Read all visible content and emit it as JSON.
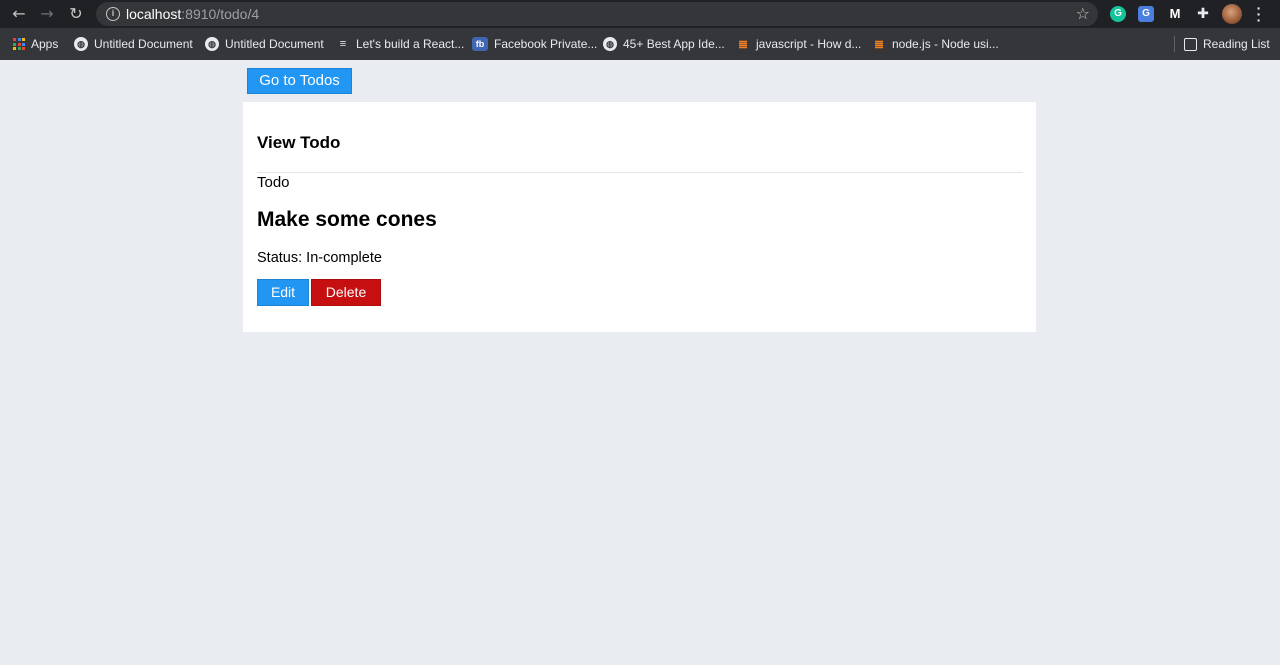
{
  "browser": {
    "url_host": "localhost",
    "url_path": ":8910/todo/4",
    "bookmarks": [
      {
        "label": "Apps",
        "icon": "apps-grid-icon"
      },
      {
        "label": "Untitled Document",
        "icon": "globe-icon"
      },
      {
        "label": "Untitled Document",
        "icon": "globe-icon"
      },
      {
        "label": "Let's build a React...",
        "icon": "list-icon"
      },
      {
        "label": "Facebook Private...",
        "icon": "fb-icon"
      },
      {
        "label": "45+ Best App Ide...",
        "icon": "globe-icon"
      },
      {
        "label": "javascript - How d...",
        "icon": "stackoverflow-icon"
      },
      {
        "label": "node.js - Node usi...",
        "icon": "stackoverflow-icon"
      }
    ],
    "reading_list": "Reading List"
  },
  "page": {
    "nav_button": "Go to Todos",
    "card_title": "View Todo",
    "section_label": "Todo",
    "todo_title": "Make some cones",
    "status": "Status: In-complete",
    "edit_button": "Edit",
    "delete_button": "Delete"
  },
  "colors": {
    "page_background": "#e9ecf0",
    "primary_blue": "#2196f3",
    "danger_red": "#c50f11"
  }
}
